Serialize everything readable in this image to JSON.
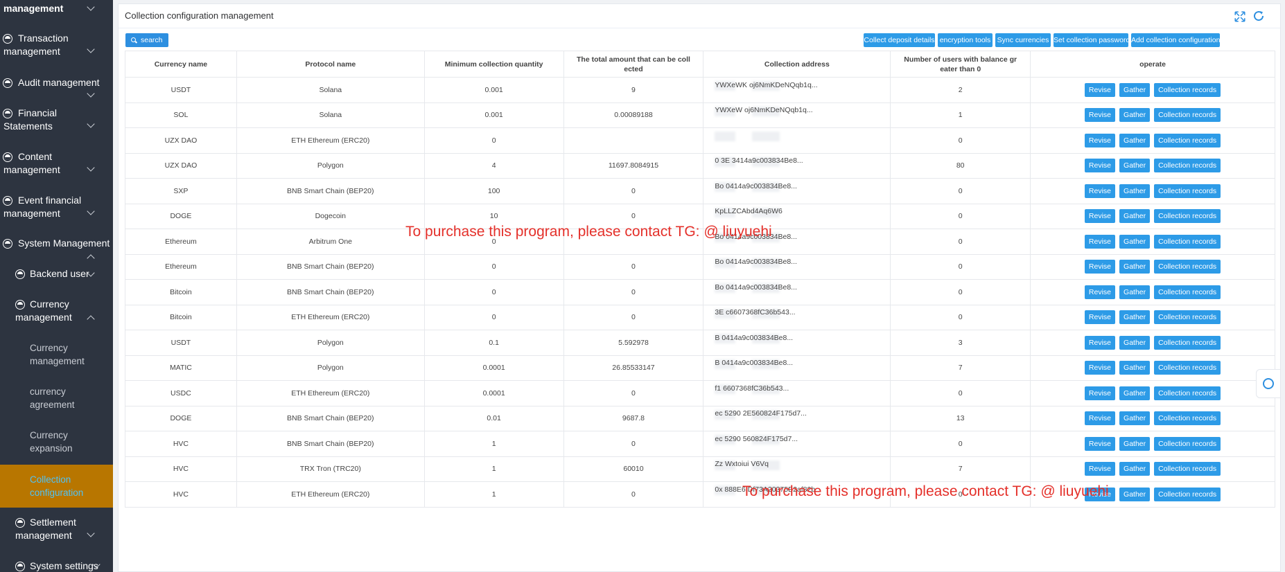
{
  "sidebar": {
    "items": [
      {
        "label": "management"
      },
      {
        "label1": "Transaction",
        "label2": "management"
      },
      {
        "label": "Audit management"
      },
      {
        "label1": "Financial",
        "label2": "Statements"
      },
      {
        "label1": "Content",
        "label2": "management"
      },
      {
        "label1": "Event financial",
        "label2": "management"
      },
      {
        "label": "System Management"
      },
      {
        "label": "Backend user"
      },
      {
        "label1": "Currency",
        "label2": "management"
      },
      {
        "label1": "Settlement",
        "label2": "management"
      },
      {
        "label": "System settings"
      }
    ],
    "subitems": [
      {
        "label1": "Currency",
        "label2": "management"
      },
      {
        "label1": "currency",
        "label2": "agreement"
      },
      {
        "label1": "Currency",
        "label2": "expansion"
      },
      {
        "label1": "Collection",
        "label2": "configuration"
      }
    ],
    "active_color": "#b87600"
  },
  "header": {
    "title": "Collection configuration management",
    "fullscreen_icon": "fullscreen-icon",
    "refresh_icon": "refresh-icon"
  },
  "toolbar": {
    "search": "search",
    "buttons": [
      "Collect deposit details",
      "encryption tools",
      "Sync currencies",
      "Set collection password",
      "Add collection configuration"
    ],
    "accent": "#2d9be7"
  },
  "table": {
    "headers": [
      "Currency name",
      "Protocol name",
      "Minimum collection quantity",
      "The total amount that can be collected",
      "Collection address",
      "Number of users with balance greater than 0",
      "operate"
    ],
    "header_lines": {
      "h3a": "The total amount that can be coll",
      "h3b": "ected",
      "h5a": "Number of users with balance gr",
      "h5b": "eater than 0"
    },
    "row_buttons": {
      "revise": "Revise",
      "gather": "Gather",
      "records": "Collection records"
    },
    "rows": [
      {
        "currency": "USDT",
        "protocol": "Solana",
        "min": "0.001",
        "total": "9",
        "address": "YWXeWK",
        "address2": "oj6NmKDeNQqb1q...",
        "users": "2"
      },
      {
        "currency": "SOL",
        "protocol": "Solana",
        "min": "0.001",
        "total": "0.00089188",
        "address": "YWXeW",
        "address2": "oj6NmKDeNQqb1q...",
        "users": "1"
      },
      {
        "currency": "UZX DAO",
        "protocol": "ETH Ethereum (ERC20)",
        "min": "0",
        "total": "",
        "address": "",
        "address2": "",
        "users": "0"
      },
      {
        "currency": "UZX DAO",
        "protocol": "Polygon",
        "min": "4",
        "total": "11697.8084915",
        "address": "0",
        "address2": "3E",
        "address3": "3414a9c003834Be8...",
        "users": "80"
      },
      {
        "currency": "SXP",
        "protocol": "BNB Smart Chain (BEP20)",
        "min": "100",
        "total": "0",
        "address": "",
        "address2": "Bo",
        "address3": "0414a9c003834Be8...",
        "users": "0"
      },
      {
        "currency": "DOGE",
        "protocol": "Dogecoin",
        "min": "10",
        "total": "0",
        "address": "",
        "address2": "",
        "address3": "KpLLZCAbd4Aq6W6",
        "users": "0"
      },
      {
        "currency": "Ethereum",
        "protocol": "Arbitrum One",
        "min": "0",
        "total": "",
        "address": "",
        "address2": "Bo",
        "address3": "0414a9c003834Be8...",
        "users": "0"
      },
      {
        "currency": "Ethereum",
        "protocol": "BNB Smart Chain (BEP20)",
        "min": "0",
        "total": "0",
        "address": "",
        "address2": "Bo",
        "address3": "0414a9c003834Be8...",
        "users": "0"
      },
      {
        "currency": "Bitcoin",
        "protocol": "BNB Smart Chain (BEP20)",
        "min": "0",
        "total": "0",
        "address": "",
        "address2": "Bo",
        "address3": "0414a9c003834Be8...",
        "users": "0"
      },
      {
        "currency": "Bitcoin",
        "protocol": "ETH Ethereum (ERC20)",
        "min": "0",
        "total": "0",
        "address": "",
        "address2": "3E",
        "address3": "c6607368fC36b543...",
        "users": "0"
      },
      {
        "currency": "USDT",
        "protocol": "Polygon",
        "min": "0.1",
        "total": "5.592978",
        "address": "",
        "address2": "B",
        "address3": "0414a9c003834Be8...",
        "users": "3"
      },
      {
        "currency": "MATIC",
        "protocol": "Polygon",
        "min": "0.0001",
        "total": "26.85533147",
        "address": "",
        "address2": "B",
        "address3": "0414a9c003834Be8...",
        "users": "7"
      },
      {
        "currency": "USDC",
        "protocol": "ETH Ethereum (ERC20)",
        "min": "0.0001",
        "total": "0",
        "address": "",
        "address2": "f1",
        "address3": "6607368fC36b543...",
        "users": "0"
      },
      {
        "currency": "DOGE",
        "protocol": "BNB Smart Chain (BEP20)",
        "min": "0.01",
        "total": "9687.8",
        "address": "ec",
        "address2": "5290",
        "address3": "2E560824F175d7...",
        "users": "13"
      },
      {
        "currency": "HVC",
        "protocol": "BNB Smart Chain (BEP20)",
        "min": "1",
        "total": "0",
        "address": "ec",
        "address2": "5290",
        "address3": "560824F175d7...",
        "users": "0"
      },
      {
        "currency": "HVC",
        "protocol": "TRX Tron (TRC20)",
        "min": "1",
        "total": "60010",
        "address": "",
        "address2": "Zz",
        "address3": "Wxtoiui V6Vq",
        "users": "7"
      },
      {
        "currency": "HVC",
        "protocol": "ETH Ethereum (ERC20)",
        "min": "1",
        "total": "0",
        "address": "0x",
        "address2": "888E6",
        "address3": "Df73A20375B2af82b...",
        "users": "0"
      }
    ]
  },
  "watermark": {
    "text1": "To purchase this program, please contact TG: @ liuyuehi",
    "text2": "To purchase this program, please contact TG: @ liuyuehi",
    "color": "#e4302a"
  }
}
